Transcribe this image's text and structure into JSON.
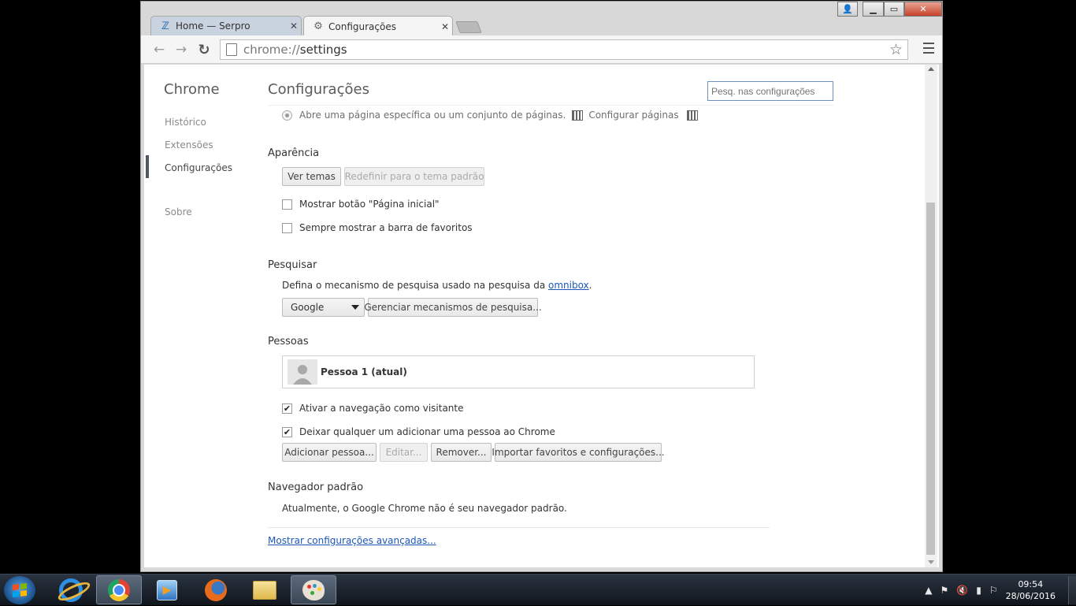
{
  "browser": {
    "tabs": [
      {
        "title": "Home — Serpro",
        "icon": "serpro-icon",
        "close": "✕"
      },
      {
        "title": "Configurações",
        "icon": "gear-icon",
        "close": "✕"
      }
    ],
    "url_scheme": "chrome://",
    "url_path": "settings"
  },
  "sidebar": {
    "title": "Chrome",
    "items": [
      {
        "label": "Histórico"
      },
      {
        "label": "Extensões"
      },
      {
        "label": "Configurações"
      },
      {
        "label": "Sobre"
      }
    ]
  },
  "main": {
    "title": "Configurações",
    "search_placeholder": "Pesq. nas configurações",
    "startup": {
      "option_label": "Abre uma página específica ou um conjunto de páginas.",
      "configure_link": "Configurar páginas"
    },
    "appearance": {
      "title": "Aparência",
      "themes_button": "Ver temas",
      "reset_theme_button": "Redefinir para o tema padrão",
      "show_home_button": "Mostrar botão \"Página inicial\"",
      "show_bookmarks_bar": "Sempre mostrar a barra de favoritos"
    },
    "search": {
      "title": "Pesquisar",
      "description": "Defina o mecanismo de pesquisa usado na pesquisa da ",
      "omnibox_link": "omnibox",
      "description_end": ".",
      "engine_selected": "Google",
      "manage_button": "Gerenciar mecanismos de pesquisa..."
    },
    "people": {
      "title": "Pessoas",
      "person_name": "Pessoa 1 (atual)",
      "guest_browsing": "Ativar a navegação como visitante",
      "anyone_add": "Deixar qualquer um adicionar uma pessoa ao Chrome",
      "guest_checked": true,
      "anyone_checked": true,
      "add_button": "Adicionar pessoa...",
      "edit_button": "Editar...",
      "remove_button": "Remover...",
      "import_button": "Importar favoritos e configurações..."
    },
    "default_browser": {
      "title": "Navegador padrão",
      "status": "Atualmente, o Google Chrome não é seu navegador padrão."
    },
    "advanced_link": "Mostrar configurações avançadas..."
  },
  "taskbar": {
    "apps": [
      "internet-explorer-icon",
      "chrome-icon",
      "media-player-icon",
      "firefox-icon",
      "file-explorer-icon",
      "paint-icon"
    ],
    "clock_time": "09:54",
    "clock_date": "28/06/2016"
  },
  "colors": {
    "link": "#1c57b8",
    "search_border": "#6e8fc2",
    "close_button": "#c7422a"
  }
}
